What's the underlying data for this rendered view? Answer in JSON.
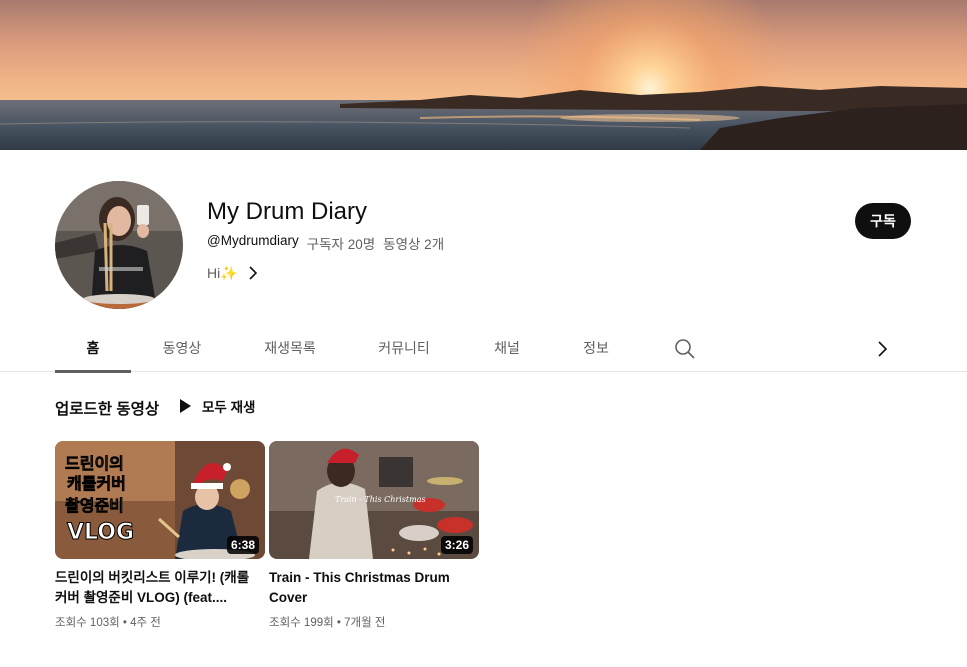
{
  "channel": {
    "name": "My Drum Diary",
    "handle": "@Mydrumdiary",
    "subscribers": "구독자 20명",
    "video_count": "동영상 2개",
    "description": "Hi✨",
    "subscribe_label": "구독"
  },
  "tabs": [
    {
      "label": "홈",
      "active": true
    },
    {
      "label": "동영상"
    },
    {
      "label": "재생목록"
    },
    {
      "label": "커뮤니티"
    },
    {
      "label": "채널"
    },
    {
      "label": "정보"
    }
  ],
  "uploads": {
    "title": "업로드한 동영상",
    "play_all_label": "모두 재생",
    "videos": [
      {
        "title": "드린이의 버킷리스트 이루기! (캐롤 커버 촬영준비 VLOG) (feat....",
        "duration": "6:38",
        "views": "조회수 103회",
        "age": "4주 전",
        "thumb_text_1": "드린이의",
        "thumb_text_2": "캐롤커버",
        "thumb_text_3": "촬영준비",
        "thumb_text_4": "VLOG"
      },
      {
        "title": "Train - This Christmas Drum Cover",
        "duration": "3:26",
        "views": "조회수 199회",
        "age": "7개월 전",
        "thumb_text_1": "Train - This Christmas"
      }
    ]
  },
  "icons": {
    "search": "search-icon",
    "next": "chevron-right-icon",
    "play": "play-icon",
    "description_more": "chevron-right-icon"
  },
  "colors": {
    "subscribe_bg": "#0f0f0f",
    "text_primary": "#0f0f0f",
    "text_secondary": "#606060",
    "divider": "#e5e5e5"
  }
}
